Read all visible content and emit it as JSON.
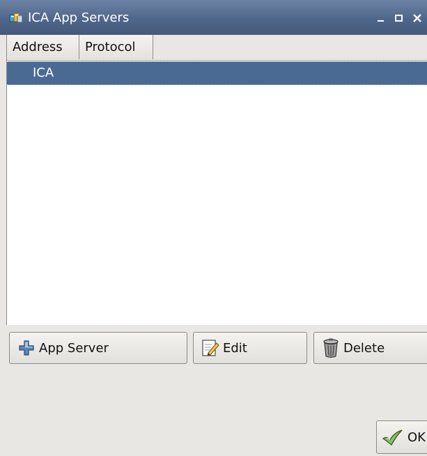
{
  "window": {
    "title": "ICA App Servers",
    "controls": {
      "minimize": "_",
      "maximize": "□",
      "close": "✕"
    },
    "titlebar_color": "#4f678b"
  },
  "list": {
    "columns": [
      "Address",
      "Protocol"
    ],
    "rows": [
      {
        "address": "",
        "protocol": "ICA",
        "selected": true
      }
    ],
    "selection_color": "#4b6a93"
  },
  "toolbar": {
    "add_label": "App Server",
    "edit_label": "Edit",
    "delete_label": "Delete"
  },
  "footer": {
    "ok_label": "OK"
  },
  "icons": {
    "app": "servers-app-icon",
    "add": "plus-icon",
    "edit": "notepad-pencil-icon",
    "delete": "trash-can-icon",
    "ok": "checkmark-icon"
  }
}
